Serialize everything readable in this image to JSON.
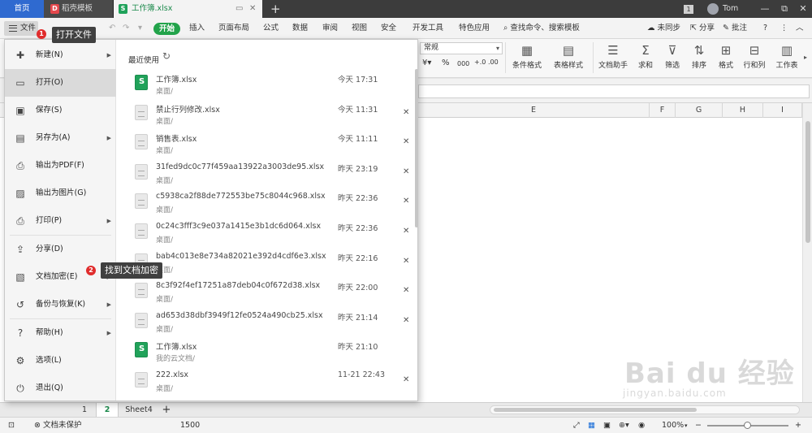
{
  "tabs": {
    "home": "首页",
    "templates": "稻壳模板",
    "file": "工作簿.xlsx",
    "templates_badge": "D",
    "file_badge": "S"
  },
  "window": {
    "page_count": "1",
    "user": "Tom",
    "minimize": "—",
    "restore": "⧉",
    "close": "✕"
  },
  "ribbon_tabs": {
    "file": "文件",
    "start": "开始",
    "items": [
      "插入",
      "页面布局",
      "公式",
      "数据",
      "审阅",
      "视图",
      "安全",
      "开发工具",
      "特色应用"
    ],
    "search": "查找命令、搜索模板",
    "not_synced": "未同步",
    "share": "分享",
    "comment": "批注"
  },
  "ribbon": {
    "number_format": "常规",
    "percent": "%",
    "thousands": "000",
    "buttons": [
      {
        "label": "条件格式",
        "icon": "▦"
      },
      {
        "label": "表格样式",
        "icon": "▤"
      },
      {
        "label": "文档助手",
        "icon": "☰"
      },
      {
        "label": "求和",
        "icon": "Σ"
      },
      {
        "label": "筛选",
        "icon": "⊽"
      },
      {
        "label": "排序",
        "icon": "⇅"
      },
      {
        "label": "格式",
        "icon": "⊞"
      },
      {
        "label": "行和列",
        "icon": "⊟"
      },
      {
        "label": "工作表",
        "icon": "▥"
      }
    ]
  },
  "grid": {
    "columns": [
      "E",
      "F",
      "G",
      "H",
      "I"
    ]
  },
  "file_menu": {
    "items": [
      {
        "label": "新建(N)",
        "icon": "✚",
        "arrow": true
      },
      {
        "label": "打开(O)",
        "icon": "▭",
        "arrow": false,
        "active": true
      },
      {
        "label": "保存(S)",
        "icon": "▣",
        "arrow": false
      },
      {
        "label": "另存为(A)",
        "icon": "▤",
        "arrow": true
      },
      {
        "label": "输出为PDF(F)",
        "icon": "⎙",
        "arrow": false
      },
      {
        "label": "输出为图片(G)",
        "icon": "▨",
        "arrow": false
      },
      {
        "label": "打印(P)",
        "icon": "⎙",
        "arrow": true
      },
      {
        "label": "分享(D)",
        "icon": "⇪",
        "arrow": false
      },
      {
        "label": "文档加密(E)",
        "icon": "▧",
        "arrow": true
      },
      {
        "label": "备份与恢复(K)",
        "icon": "↺",
        "arrow": true
      },
      {
        "label": "帮助(H)",
        "icon": "?",
        "arrow": true
      },
      {
        "label": "选项(L)",
        "icon": "⚙",
        "arrow": false
      },
      {
        "label": "退出(Q)",
        "icon": "⏻",
        "arrow": false
      }
    ],
    "recent_title": "最近使用",
    "recent": [
      {
        "name": "工作簿.xlsx",
        "path": "桌面/",
        "time": "今天 17:31",
        "green": true,
        "closable": false
      },
      {
        "name": "禁止行列修改.xlsx",
        "path": "桌面/",
        "time": "今天 11:31",
        "green": false,
        "closable": true
      },
      {
        "name": "销售表.xlsx",
        "path": "桌面/",
        "time": "今天 11:11",
        "green": false,
        "closable": true
      },
      {
        "name": "31fed9dc0c77f459aa13922a3003de95.xlsx",
        "path": "桌面/",
        "time": "昨天 23:19",
        "green": false,
        "closable": true
      },
      {
        "name": "c5938ca2f88de772553be75c8044c968.xlsx",
        "path": "桌面/",
        "time": "昨天 22:36",
        "green": false,
        "closable": true
      },
      {
        "name": "0c24c3fff3c9e037a1415e3b1dc6d064.xlsx",
        "path": "桌面/",
        "time": "昨天 22:36",
        "green": false,
        "closable": true
      },
      {
        "name": "bab4c013e8e734a82021e392d4cdf6e3.xlsx",
        "path": "桌面/",
        "time": "昨天 22:16",
        "green": false,
        "closable": true
      },
      {
        "name": "8c3f92f4ef17251a87deb04c0f672d38.xlsx",
        "path": "桌面/",
        "time": "昨天 22:00",
        "green": false,
        "closable": true
      },
      {
        "name": "ad653d38dbf3949f12fe0524a490cb25.xlsx",
        "path": "桌面/",
        "time": "昨天 21:14",
        "green": false,
        "closable": true
      },
      {
        "name": "工作簿.xlsx",
        "path": "我的云文档/",
        "time": "昨天 21:10",
        "green": true,
        "closable": false
      },
      {
        "name": "222.xlsx",
        "path": "桌面/",
        "time": "11-21 22:43",
        "green": false,
        "closable": true
      }
    ]
  },
  "callouts": {
    "open": {
      "num": "1",
      "text": "打开文件"
    },
    "encrypt": {
      "num": "2",
      "text": "找到文档加密"
    }
  },
  "sheets": {
    "tab1": "1",
    "tab2": "2",
    "tab3": "Sheet4",
    "add": "+"
  },
  "status": {
    "protect": "文档未保护",
    "value": "1500",
    "zoom": "100%",
    "zoom_out": "−",
    "zoom_in": "+"
  },
  "watermark": {
    "text": "Bai du 经验",
    "url": "jingyan.baidu.com"
  },
  "colors": {
    "accent_green": "#22a34a",
    "tab_blue": "#2f6ad0",
    "callout_red": "#e02c2c"
  }
}
